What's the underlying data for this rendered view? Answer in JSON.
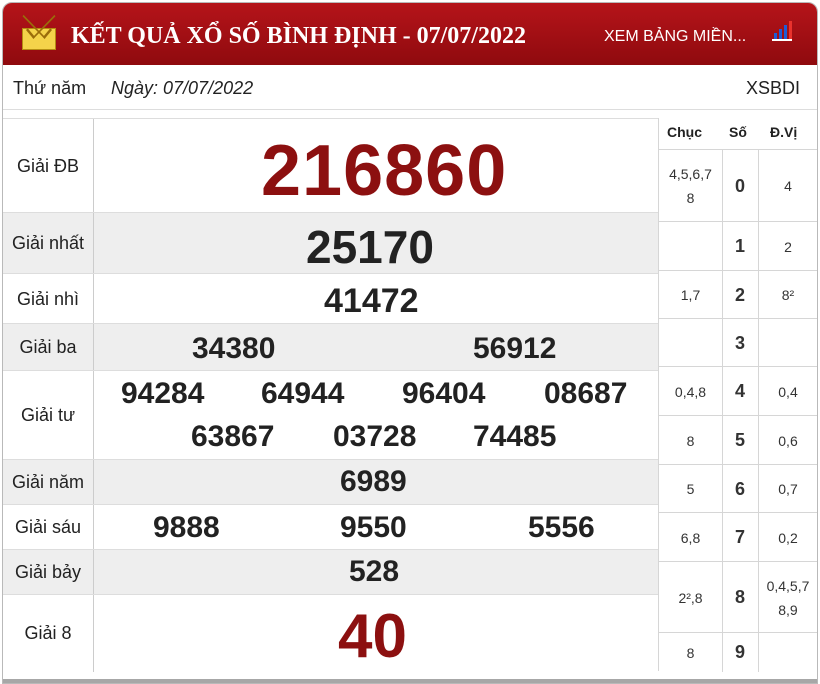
{
  "header": {
    "title": "KẾT QUẢ XỔ SỐ BÌNH ĐỊNH - 07/07/2022",
    "link": "XEM BẢNG MIỀN...",
    "icons": [
      "mail-icon",
      "bar-chart-icon"
    ],
    "colors": {
      "bar": "#a70f14",
      "text": "#ffffff"
    }
  },
  "info": {
    "weekday": "Thứ năm",
    "date": "Ngày: 07/07/2022",
    "code": "XSBDI"
  },
  "results": [
    {
      "label": "Giải ĐB",
      "numbers": [
        "216860"
      ]
    },
    {
      "label": "Giải nhất",
      "numbers": [
        "25170"
      ]
    },
    {
      "label": "Giải nhì",
      "numbers": [
        "41472"
      ]
    },
    {
      "label": "Giải ba",
      "numbers": [
        "34380",
        "56912"
      ]
    },
    {
      "label": "Giải tư",
      "numbers": [
        "94284",
        "64944",
        "96404",
        "08687",
        "63867",
        "03728",
        "74485"
      ]
    },
    {
      "label": "Giải năm",
      "numbers": [
        "6989"
      ]
    },
    {
      "label": "Giải sáu",
      "numbers": [
        "9888",
        "9550",
        "5556"
      ]
    },
    {
      "label": "Giải bảy",
      "numbers": [
        "528"
      ]
    },
    {
      "label": "Giải 8",
      "numbers": [
        "40"
      ]
    }
  ],
  "loto": {
    "headers": [
      "Chục",
      "Số",
      "Đ.Vị"
    ],
    "rows": [
      {
        "chuc": "4,5,6,7\n8",
        "so": "0",
        "dvi": "4"
      },
      {
        "chuc": "",
        "so": "1",
        "dvi": "2"
      },
      {
        "chuc": "1,7",
        "so": "2",
        "dvi": "8²"
      },
      {
        "chuc": "",
        "so": "3",
        "dvi": ""
      },
      {
        "chuc": "0,4,8",
        "so": "4",
        "dvi": "0,4"
      },
      {
        "chuc": "8",
        "so": "5",
        "dvi": "0,6"
      },
      {
        "chuc": "5",
        "so": "6",
        "dvi": "0,7"
      },
      {
        "chuc": "6,8",
        "so": "7",
        "dvi": "0,2"
      },
      {
        "chuc": "2²,8",
        "so": "8",
        "dvi": "0,4,5,7\n8,9"
      },
      {
        "chuc": "8",
        "so": "9",
        "dvi": ""
      }
    ]
  }
}
